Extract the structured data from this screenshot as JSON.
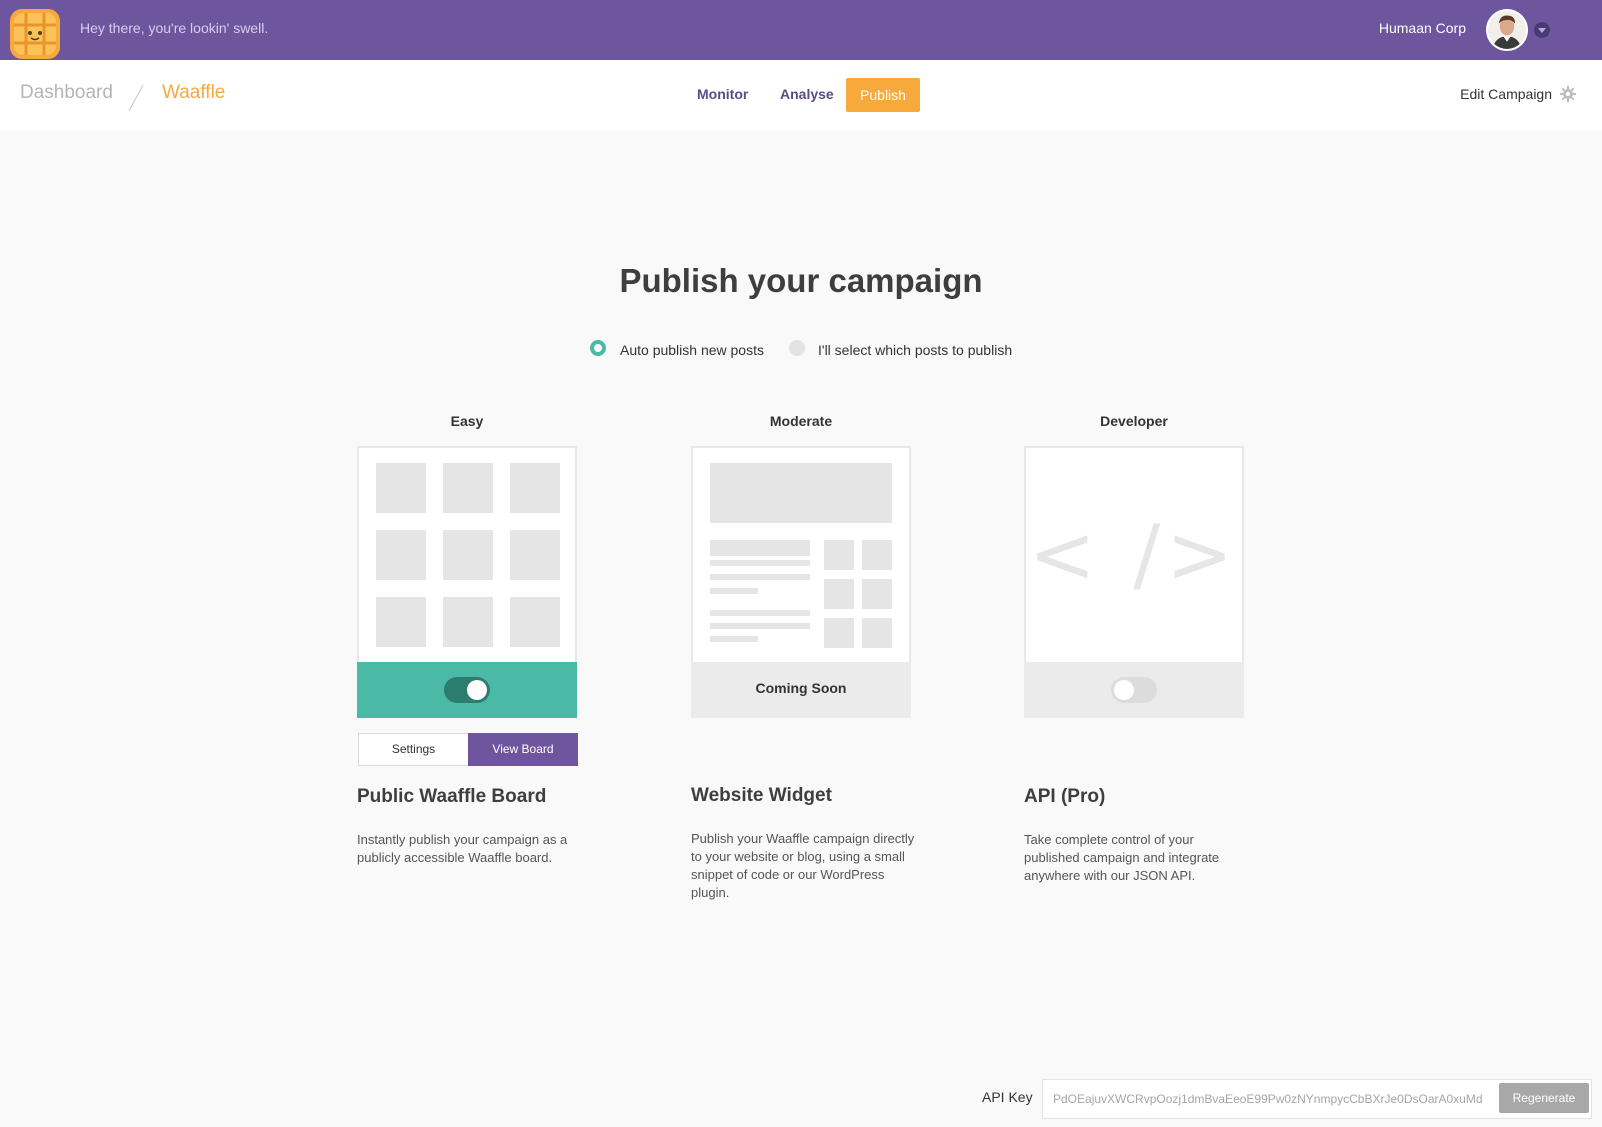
{
  "topbar": {
    "greeting": "Hey there, you're lookin' swell.",
    "company": "Humaan Corp",
    "color": "#6e569f"
  },
  "breadcrumb": {
    "root": "Dashboard",
    "current": "Waaffle"
  },
  "nav": {
    "tabs": [
      {
        "label": "Monitor"
      },
      {
        "label": "Analyse"
      },
      {
        "label": "Publish",
        "active": true
      }
    ],
    "edit_campaign": "Edit Campaign"
  },
  "main": {
    "title": "Publish your campaign",
    "options": [
      {
        "label": "Auto publish new posts",
        "selected": true
      },
      {
        "label": "I'll select which posts to publish",
        "selected": false
      }
    ],
    "columns": [
      {
        "level": "Easy",
        "title": "Public Waaffle Board",
        "description": "Instantly publish your campaign as a publicly accessible Waaffle board.",
        "enabled": true,
        "buttons": {
          "settings": "Settings",
          "view": "View Board"
        }
      },
      {
        "level": "Moderate",
        "title": "Website Widget",
        "description": "Publish your Waaffle campaign directly to your website or blog, using a small snippet of code or our WordPress plugin.",
        "status": "Coming Soon"
      },
      {
        "level": "Developer",
        "title": "API (Pro)",
        "description": "Take complete control of your published campaign and integrate anywhere with our JSON API.",
        "enabled": false,
        "glyph": "< />"
      }
    ]
  },
  "api": {
    "label": "API Key",
    "key": "PdOEajuvXWCRvpOozj1dmBvaEeoE99Pw0zNYnmpycCbBXrJe0DsOarA0xuMd",
    "regenerate": "Regenerate"
  },
  "colors": {
    "accent_orange": "#f7a93b",
    "accent_teal": "#4ab9a6",
    "brand_purple": "#6e569f"
  }
}
